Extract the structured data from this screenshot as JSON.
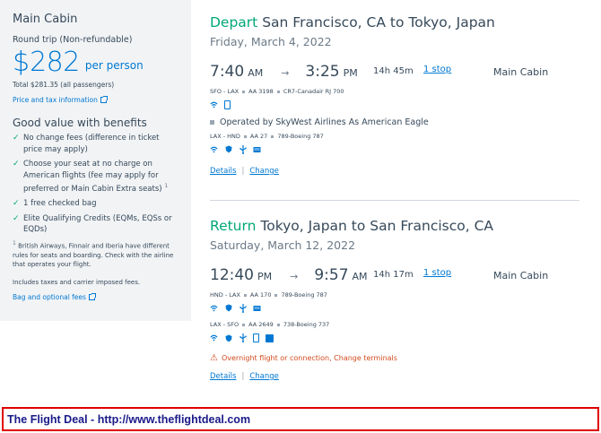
{
  "sidebar": {
    "cabin": "Main Cabin",
    "trip_type": "Round trip (Non-refundable)",
    "price_currency": "$",
    "price_value": "282",
    "price_per": "per person",
    "total": "Total $281.35 (all passengers)",
    "price_tax_link": "Price and tax information",
    "benefits_title": "Good value with benefits",
    "benefits": [
      "No change fees (difference in ticket price may apply)",
      "Choose your seat at no charge on American flights (fee may apply for preferred or Main Cabin Extra seats)",
      "1 free checked bag",
      "Elite Qualifying Credits (EQMs, EQSs or EQDs)"
    ],
    "benefit_footnote_marker": "1",
    "footnote": "British Airways, Finnair and Iberia have different rules for seats and boarding. Check with the airline that operates your flight.",
    "includes": "Includes taxes and carrier imposed fees.",
    "bag_link": "Bag and optional fees"
  },
  "outbound": {
    "kind": "Depart",
    "route": "San Francisco, CA to Tokyo, Japan",
    "date": "Friday, March 4, 2022",
    "dep_time": "7:40",
    "dep_ampm": "AM",
    "arrow": "→",
    "arr_time": "3:25",
    "arr_ampm": "PM",
    "duration": "14h  45m",
    "stops": "1 stop",
    "cabin": "Main Cabin",
    "seg1_route": "SFO - LAX",
    "seg1_flight": "AA 3198",
    "seg1_aircraft": "CR7-Canadair RJ 700",
    "operated": "Operated by SkyWest Airlines As American Eagle",
    "seg2_route": "LAX - HND",
    "seg2_flight": "AA 27",
    "seg2_aircraft": "789-Boeing 787",
    "details": "Details",
    "change": "Change",
    "sep": "|"
  },
  "return": {
    "kind": "Return",
    "route": "Tokyo, Japan to San Francisco, CA",
    "date": "Saturday, March 12, 2022",
    "dep_time": "12:40",
    "dep_ampm": "PM",
    "arrow": "→",
    "arr_time": "9:57",
    "arr_ampm": "AM",
    "duration": "14h  17m",
    "stops": "1 stop",
    "cabin": "Main Cabin",
    "seg1_route": "HND - LAX",
    "seg1_flight": "AA 170",
    "seg1_aircraft": "789-Boeing 787",
    "seg2_route": "LAX - SFO",
    "seg2_flight": "AA 2649",
    "seg2_aircraft": "738-Boeing 737",
    "warning": "Overnight flight or connection, Change terminals",
    "details": "Details",
    "change": "Change",
    "sep": "|"
  },
  "banner": {
    "text": "The Flight Deal - http://www.theflightdeal.com"
  },
  "colors": {
    "accent": "#0078d2",
    "green": "#00a878",
    "warning": "#d14b1e",
    "banner_border": "#e00000"
  }
}
